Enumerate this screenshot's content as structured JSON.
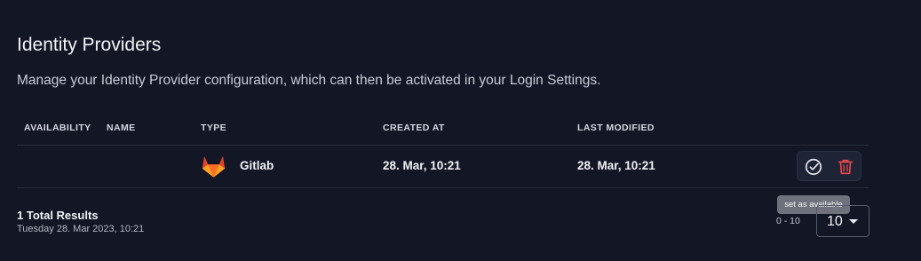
{
  "header": {
    "title": "Identity Providers",
    "description": "Manage your Identity Provider configuration, which can then be activated in your Login Settings."
  },
  "table": {
    "columns": [
      "AVAILABILITY",
      "NAME",
      "TYPE",
      "CREATED AT",
      "LAST MODIFIED"
    ],
    "rows": [
      {
        "availability": "",
        "name": "",
        "type": "Gitlab",
        "type_icon": "gitlab-icon",
        "created_at": "28. Mar, 10:21",
        "last_modified": "28. Mar, 10:21",
        "actions": [
          "check-circle-icon",
          "trash-icon"
        ]
      }
    ]
  },
  "tooltip": {
    "text": "set as available"
  },
  "footer": {
    "total_results": "1 Total Results",
    "timestamp": "Tuesday 28. Mar 2023, 10:21",
    "range": "0 - 10",
    "page_size": "10"
  },
  "colors": {
    "background": "#131725",
    "gitlab_orange": "#e2432a",
    "delete_red": "#e5484d",
    "check_white": "#e6e8ef"
  }
}
